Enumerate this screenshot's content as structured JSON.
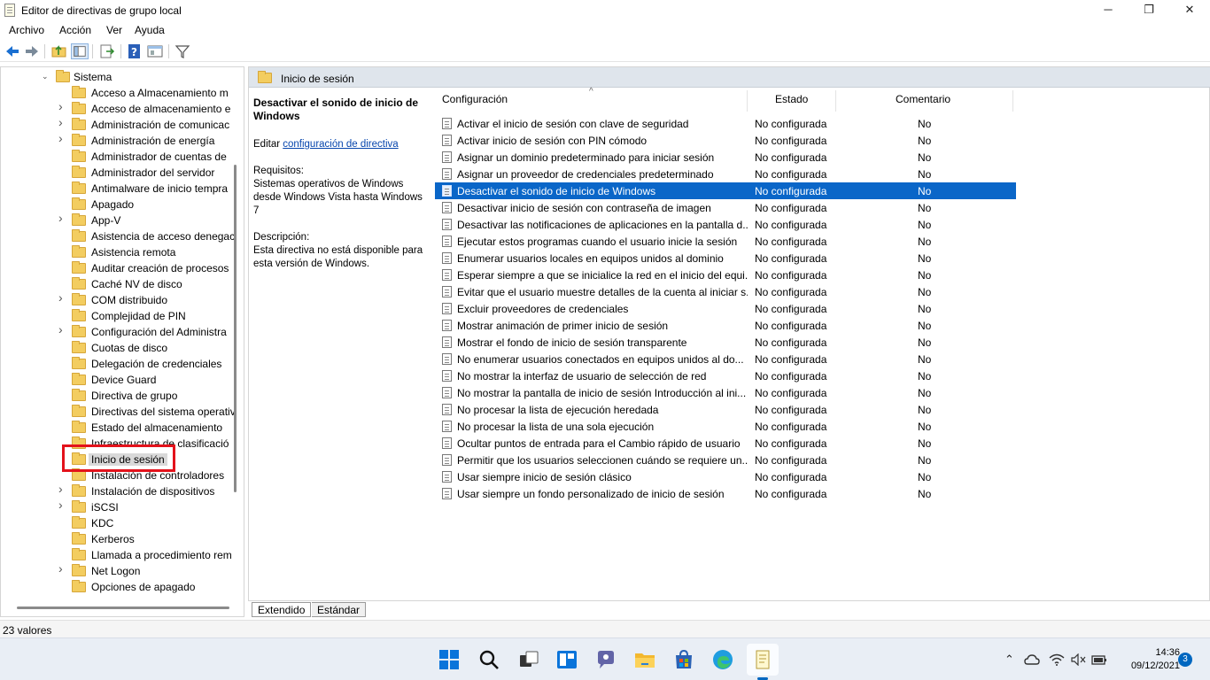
{
  "window": {
    "title": "Editor de directivas de grupo local",
    "minimize": "─",
    "maximize": "❐",
    "close": "✕"
  },
  "menu": [
    "Archivo",
    "Acción",
    "Ver",
    "Ayuda"
  ],
  "tree": {
    "parent": "Sistema",
    "items": [
      {
        "label": "Acceso a Almacenamiento m",
        "expandable": false
      },
      {
        "label": "Acceso de almacenamiento e",
        "expandable": true
      },
      {
        "label": "Administración de comunicac",
        "expandable": true
      },
      {
        "label": "Administración de energía",
        "expandable": true
      },
      {
        "label": "Administrador de cuentas de",
        "expandable": false
      },
      {
        "label": "Administrador del servidor",
        "expandable": false
      },
      {
        "label": "Antimalware de inicio tempra",
        "expandable": false
      },
      {
        "label": "Apagado",
        "expandable": false
      },
      {
        "label": "App-V",
        "expandable": true
      },
      {
        "label": "Asistencia de acceso denegac",
        "expandable": false
      },
      {
        "label": "Asistencia remota",
        "expandable": false
      },
      {
        "label": "Auditar creación de procesos",
        "expandable": false
      },
      {
        "label": "Caché NV de disco",
        "expandable": false
      },
      {
        "label": "COM distribuido",
        "expandable": true
      },
      {
        "label": "Complejidad de PIN",
        "expandable": false
      },
      {
        "label": "Configuración del Administra",
        "expandable": true
      },
      {
        "label": "Cuotas de disco",
        "expandable": false
      },
      {
        "label": "Delegación de credenciales",
        "expandable": false
      },
      {
        "label": "Device Guard",
        "expandable": false
      },
      {
        "label": "Directiva de grupo",
        "expandable": false
      },
      {
        "label": "Directivas del sistema operativ",
        "expandable": false
      },
      {
        "label": "Estado del almacenamiento",
        "expandable": false
      },
      {
        "label": "Infraestructura de clasificació",
        "expandable": false
      },
      {
        "label": "Inicio de sesión",
        "expandable": false,
        "selected": true
      },
      {
        "label": "Instalación de controladores",
        "expandable": false
      },
      {
        "label": "Instalación de dispositivos",
        "expandable": true
      },
      {
        "label": "iSCSI",
        "expandable": true
      },
      {
        "label": "KDC",
        "expandable": false
      },
      {
        "label": "Kerberos",
        "expandable": false
      },
      {
        "label": "Llamada a procedimiento rem",
        "expandable": false
      },
      {
        "label": "Net Logon",
        "expandable": true
      },
      {
        "label": "Opciones de apagado",
        "expandable": false
      }
    ]
  },
  "right": {
    "header": "Inicio de sesión",
    "description": {
      "title": "Desactivar el sonido de inicio de Windows",
      "edit_prefix": "Editar",
      "edit_link": "configuración de directiva",
      "requirements_label": "Requisitos:",
      "requirements": "Sistemas operativos de Windows desde Windows Vista hasta Windows 7",
      "description_label": "Descripción:",
      "description": "Esta directiva no está disponible para esta versión de Windows."
    },
    "columns": {
      "config": "Configuración",
      "state": "Estado",
      "comment": "Comentario"
    },
    "rows": [
      {
        "name": "Activar el inicio de sesión con clave de seguridad",
        "state": "No configurada",
        "comment": "No"
      },
      {
        "name": "Activar inicio de sesión con PIN cómodo",
        "state": "No configurada",
        "comment": "No"
      },
      {
        "name": "Asignar un dominio predeterminado para iniciar sesión",
        "state": "No configurada",
        "comment": "No"
      },
      {
        "name": "Asignar un proveedor de credenciales predeterminado",
        "state": "No configurada",
        "comment": "No"
      },
      {
        "name": "Desactivar el sonido de inicio de Windows",
        "state": "No configurada",
        "comment": "No",
        "selected": true
      },
      {
        "name": "Desactivar inicio de sesión con contraseña de imagen",
        "state": "No configurada",
        "comment": "No"
      },
      {
        "name": "Desactivar las notificaciones de aplicaciones en la pantalla d...",
        "state": "No configurada",
        "comment": "No"
      },
      {
        "name": "Ejecutar estos programas cuando el usuario inicie la sesión",
        "state": "No configurada",
        "comment": "No"
      },
      {
        "name": "Enumerar usuarios locales en equipos unidos al dominio",
        "state": "No configurada",
        "comment": "No"
      },
      {
        "name": "Esperar siempre a que se inicialice la red en el inicio del equi...",
        "state": "No configurada",
        "comment": "No"
      },
      {
        "name": "Evitar que el usuario muestre detalles de la cuenta al iniciar s...",
        "state": "No configurada",
        "comment": "No"
      },
      {
        "name": "Excluir proveedores de credenciales",
        "state": "No configurada",
        "comment": "No"
      },
      {
        "name": "Mostrar animación de primer inicio de sesión",
        "state": "No configurada",
        "comment": "No"
      },
      {
        "name": "Mostrar el fondo de inicio de sesión transparente",
        "state": "No configurada",
        "comment": "No"
      },
      {
        "name": "No enumerar usuarios conectados en equipos unidos al do...",
        "state": "No configurada",
        "comment": "No"
      },
      {
        "name": "No mostrar la interfaz de usuario de selección de red",
        "state": "No configurada",
        "comment": "No"
      },
      {
        "name": "No mostrar la pantalla de inicio de sesión Introducción al ini...",
        "state": "No configurada",
        "comment": "No"
      },
      {
        "name": "No procesar la lista de ejecución heredada",
        "state": "No configurada",
        "comment": "No"
      },
      {
        "name": "No procesar la lista de una sola ejecución",
        "state": "No configurada",
        "comment": "No"
      },
      {
        "name": "Ocultar puntos de entrada para el Cambio rápido de usuario",
        "state": "No configurada",
        "comment": "No"
      },
      {
        "name": "Permitir que los usuarios seleccionen cuándo se requiere un...",
        "state": "No configurada",
        "comment": "No"
      },
      {
        "name": "Usar siempre inicio de sesión clásico",
        "state": "No configurada",
        "comment": "No"
      },
      {
        "name": "Usar siempre un fondo personalizado de inicio de sesión",
        "state": "No configurada",
        "comment": "No"
      }
    ]
  },
  "tabs": {
    "extended": "Extendido",
    "standard": "Estándar"
  },
  "status": {
    "text": "23 valores"
  },
  "taskbar": {
    "time": "14:36",
    "date": "09/12/2021",
    "notifications": "3"
  },
  "colors": {
    "selection": "#0a66c8",
    "highlight_box": "#e3121b",
    "folder": "#f3cd60"
  }
}
